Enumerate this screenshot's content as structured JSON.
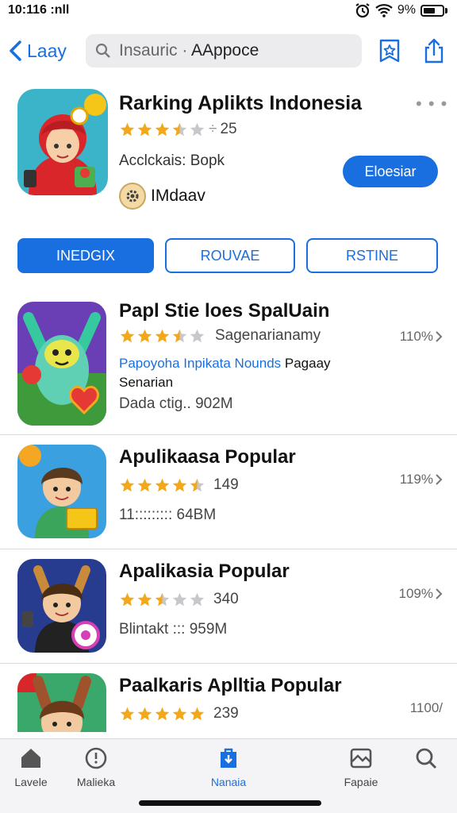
{
  "status": {
    "time": "10:116 :nll",
    "battery_text": "9%"
  },
  "nav": {
    "back_label": "Laay",
    "search_hint": "Insauric ·",
    "search_value": "AAppoce"
  },
  "featured": {
    "title": "Rarking Aplikts Indonesia",
    "rating_count": "25",
    "rating": 3.5,
    "category": "Acclckais: Bopk",
    "button_label": "Eloesiar",
    "developer": "IMdaav",
    "more_label": "• • •"
  },
  "tabs": [
    {
      "label": "INEDGIX",
      "active": true
    },
    {
      "label": "ROUVAE",
      "active": false
    },
    {
      "label": "RSTINE",
      "active": false
    }
  ],
  "apps": [
    {
      "title": "Papl Stie loes SpalUain",
      "rating": 3.5,
      "rating_text": "Sagenarianamy",
      "desc_highlight": "Papoyoha Inpikata Nounds",
      "desc_rest": " Pagaay Senarian",
      "meta": "Dada ctig..   902M",
      "percent": "110%"
    },
    {
      "title": "Apulikaasa Popular",
      "rating": 4.5,
      "rating_text": "149",
      "meta": "11:::::::::  64BM",
      "percent": "119%"
    },
    {
      "title": "Apalikasia Popular",
      "rating": 2.5,
      "rating_text": "340",
      "meta": "Blintakt  :::  959M",
      "percent": "109%"
    },
    {
      "title": "Paalkaris Aplltia Popular",
      "rating": 5,
      "rating_text": "239",
      "meta": "",
      "percent": "1100/"
    }
  ],
  "tabbar": [
    {
      "label": "Lavele",
      "icon": "home-icon",
      "active": false
    },
    {
      "label": "Malieka",
      "icon": "clock-icon",
      "active": false
    },
    {
      "label": "Nanaia",
      "icon": "apps-icon",
      "active": true
    },
    {
      "label": "Fapaie",
      "icon": "photo-icon",
      "active": false
    },
    {
      "label": "",
      "icon": "search-icon",
      "active": false
    }
  ],
  "colors": {
    "accent": "#1a6fe0",
    "star": "#f2a81d",
    "star_empty": "#c8c8cc"
  }
}
